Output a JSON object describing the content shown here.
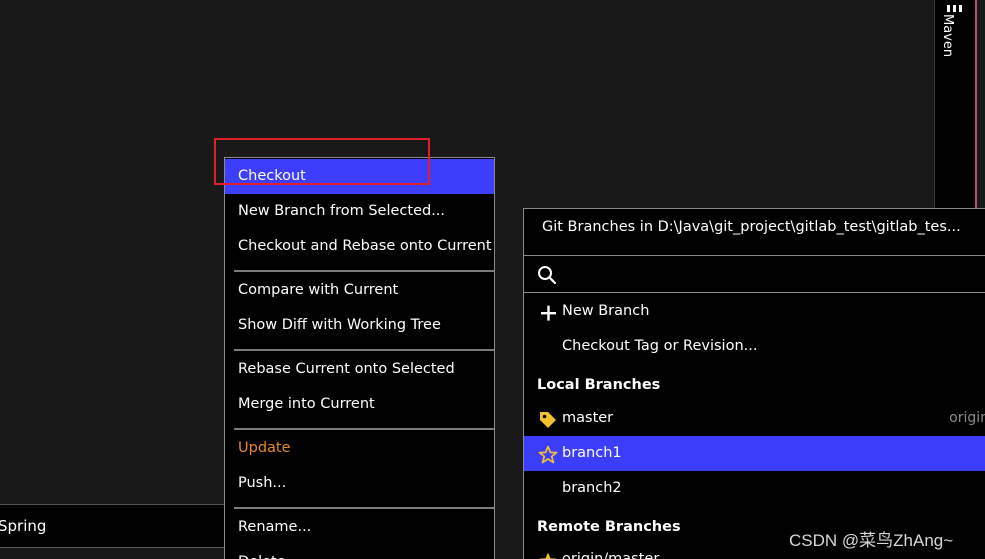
{
  "tool_strip": {
    "maven_label": "Maven",
    "maven_icon": "maven-icon",
    "accent_color": "#c44a6a"
  },
  "bottom_bar": {
    "spring_tab": "Spring"
  },
  "context_menu": {
    "selected_color": "#3d3dfc",
    "items": [
      {
        "label": "Checkout",
        "selected": true
      },
      {
        "label": "New Branch from Selected..."
      },
      {
        "label": "Checkout and Rebase onto Current"
      },
      {
        "label": "Compare with Current"
      },
      {
        "label": "Show Diff with Working Tree"
      },
      {
        "label": "Rebase Current onto Selected"
      },
      {
        "label": "Merge into Current"
      },
      {
        "label": "Update",
        "color": "#e8862e"
      },
      {
        "label": "Push..."
      },
      {
        "label": "Rename..."
      },
      {
        "label": "Delete"
      }
    ]
  },
  "branches_popup": {
    "title": "Git Branches in D:\\Java\\git_project\\gitlab_test\\gitlab_tes...",
    "search_icon": "search-icon",
    "new_branch": "New Branch",
    "checkout_tag": "Checkout Tag or Revision...",
    "local_header": "Local Branches",
    "local": [
      {
        "name": "master",
        "icon": "tag-icon",
        "remote": "origin"
      },
      {
        "name": "branch1",
        "icon": "star-icon",
        "selected": true
      },
      {
        "name": "branch2"
      }
    ],
    "remote_header": "Remote Branches",
    "remote": [
      {
        "name": "origin/master",
        "icon": "star-icon"
      }
    ]
  },
  "watermark": "CSDN @菜鸟ZhAng~"
}
